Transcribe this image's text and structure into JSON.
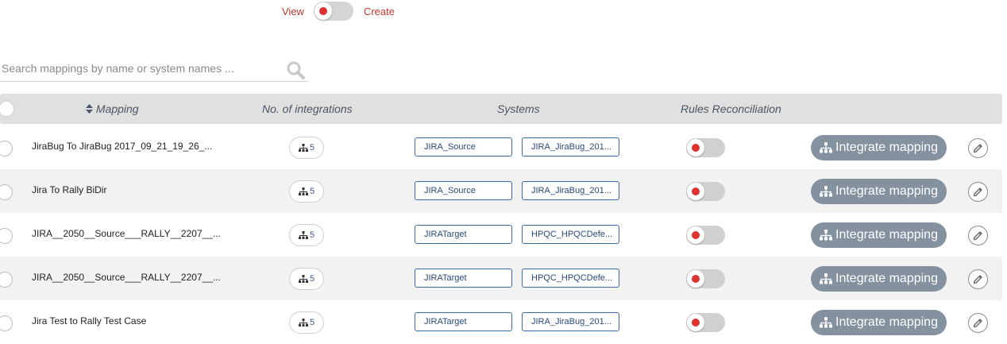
{
  "mode_toggle": {
    "left_label": "View",
    "right_label": "Create",
    "state": "view"
  },
  "search": {
    "placeholder": "Search mappings by name or system names ...",
    "value": ""
  },
  "table": {
    "columns": {
      "mapping": "Mapping",
      "integrations": "No. of integrations",
      "systems": "Systems",
      "rules": "Rules Reconciliation"
    },
    "action_label": "Integrate mapping",
    "rows": [
      {
        "name": "JiraBug To JiraBug 2017_09_21_19_26_...",
        "integrations": "5",
        "system1": "JIRA_Source",
        "system2": "JIRA_JiraBug_201...",
        "rules_on": false
      },
      {
        "name": "Jira To Rally BiDir",
        "integrations": "5",
        "system1": "JIRA_Source",
        "system2": "JIRA_JiraBug_201...",
        "rules_on": false
      },
      {
        "name": "JIRA__2050__Source___RALLY__2207__...",
        "integrations": "5",
        "system1": "JIRATarget",
        "system2": "HPQC_HPQCDefe...",
        "rules_on": false
      },
      {
        "name": "JIRA__2050__Source___RALLY__2207__...",
        "integrations": "5",
        "system1": "JIRATarget",
        "system2": "HPQC_HPQCDefe...",
        "rules_on": false
      },
      {
        "name": "Jira Test to Rally Test Case",
        "integrations": "5",
        "system1": "JIRATarget",
        "system2": "JIRA_JiraBug_201...",
        "rules_on": false
      }
    ]
  },
  "colors": {
    "accent_red": "#e03131",
    "label_red": "#c0392b",
    "header_bg": "#e0e0e0",
    "button_bg": "#8492a0",
    "system_border": "#3a6aa8"
  },
  "icons": {
    "search": "search-icon",
    "sort": "sort-icon",
    "sitemap": "sitemap-icon",
    "edit": "pencil-icon"
  }
}
